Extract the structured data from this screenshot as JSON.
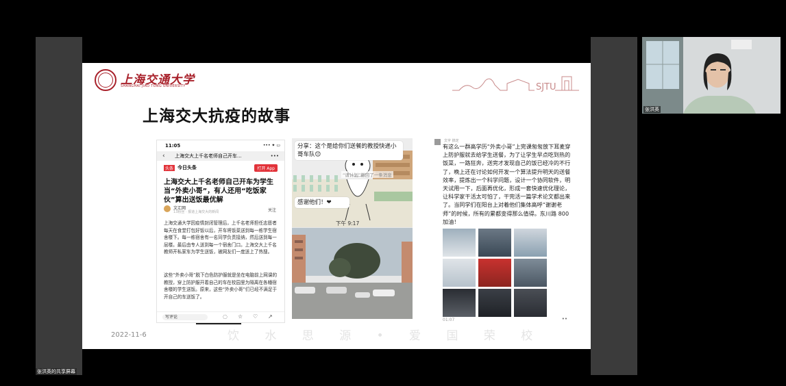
{
  "slide": {
    "logo_cn": "上海交通大学",
    "logo_en": "SHANGHAI JIAO TONG UNIVERSITY",
    "deco_text": "SJTU",
    "title": "上海交大抗疫的故事",
    "date": "2022-11-6",
    "motto": "饮 水 思 源 • 爱 国 荣 校"
  },
  "phone": {
    "time": "11:05",
    "status_right": "••• ✦ ▭",
    "back": "‹",
    "header_title": "上海交大上千名老师自己开车...",
    "more": "•••",
    "tag": "头条",
    "app_name": "今日头条",
    "open_button": "打开 App",
    "app_sub": "",
    "headline": "上海交大上千名老师自己开车为学生当“外卖小哥”，有人还用“吃饭家伙”算出送饭最优解",
    "source": "文汇网",
    "source_sub": "13粉丝 · 报道上海交大的新闻",
    "follow": "关注",
    "para1": "上海交通大学因疫情封闭管理后，上千名老师担任志愿者每天在食堂打包好饭以后，开车将饭菜送到每一栋学生宿舍楼下。每一栋宿舍有一名同学负责接纳，然后送到每一层楼。最后由专人送到每一个宿舍门口。上海交大上千名教师开私家车为学生送饭，被网友们一度送上了热搜。",
    "para2": "这些“外卖小哥”脱下白色防护服就是坐在电脑前上网课的教授，穿上防护服开着自己的车在校园里为隔离在各幢宿舍楼的学生送饭。原来，这些“外卖小哥”们已经不满足于开自己的车送饭了。",
    "comment_placeholder": "写评论"
  },
  "chat": {
    "bubble1": "分享：这个是给你们送餐的教授快递小哥车队😊",
    "recall": "“请计划”撤回了一条消息",
    "bubble2": "感谢他们！❤",
    "time": "下午 9:17"
  },
  "moment": {
    "name": "文字 搞定",
    "text": "有这么一群高学历“外卖小哥”上完课匆匆放下耳麦穿上防护服就去给学生送餐，为了让学生早点吃到热的饭菜，一路狂奔，送完才发现自己的饭已经冷的不行了，晚上还在讨论如何开发一个算法提升明天的送餐效率，提炼出一个科学问题，设计一个协同软件，明天试用一下，后面再优化，形成一套快速优化理论，让科学家干活太可怕了，干完活一篇学术论文都出来了。当同学们在阳台上对着他们集体高呼“谢谢老师”的时候，所有的累都变得那么值得。东川路 800 加油！",
    "time": "01:07",
    "dots": "••"
  },
  "webcam": {
    "name": "张洪英"
  },
  "share_label": "张洪英的共享屏幕"
}
